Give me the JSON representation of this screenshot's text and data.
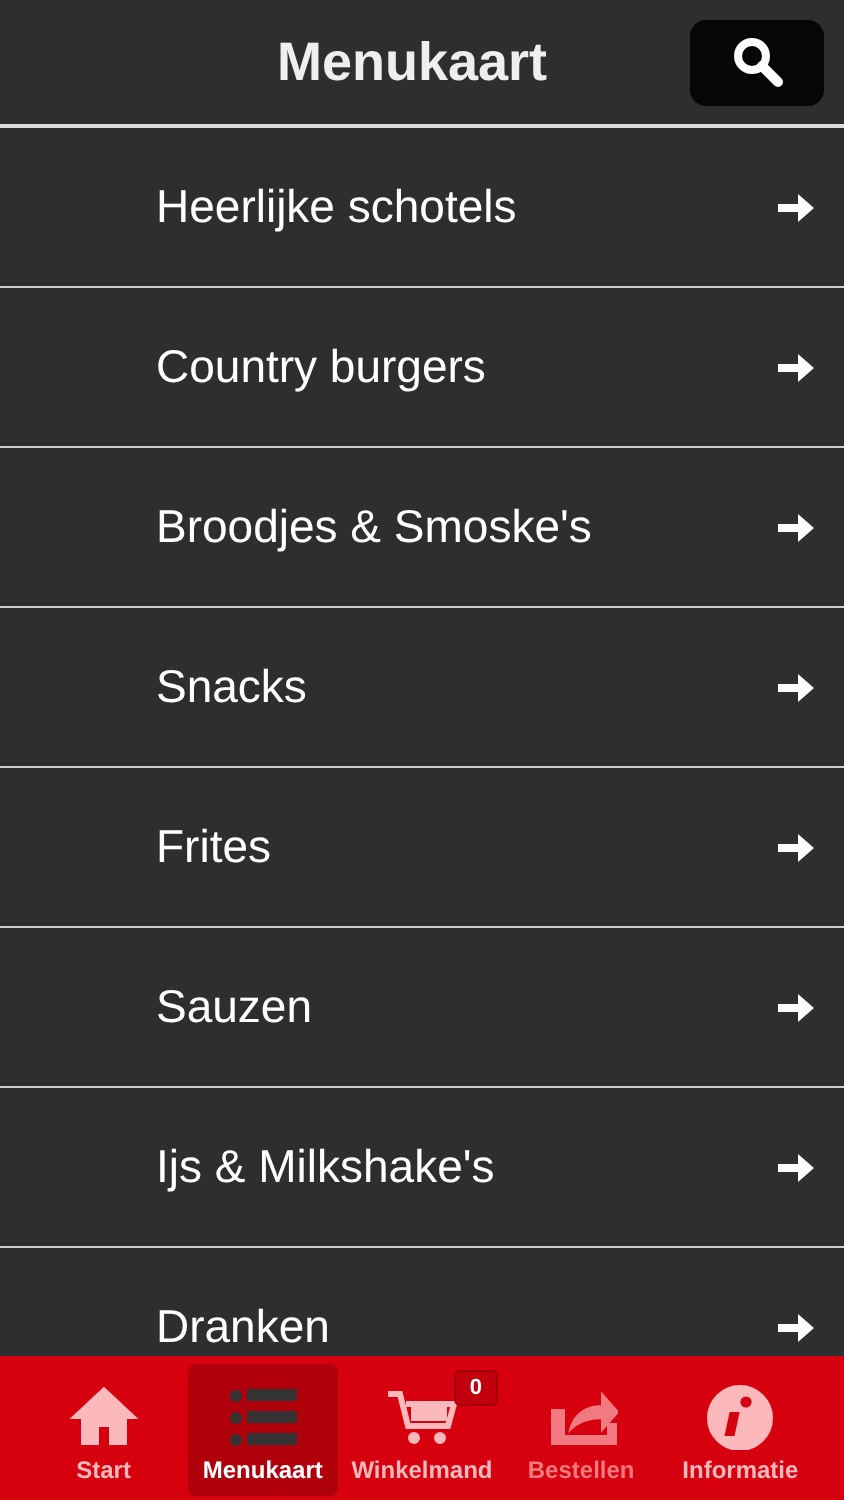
{
  "header": {
    "title": "Menukaart"
  },
  "categories": [
    {
      "label": "Heerlijke schotels"
    },
    {
      "label": "Country burgers"
    },
    {
      "label": "Broodjes & Smoske's"
    },
    {
      "label": "Snacks"
    },
    {
      "label": "Frites"
    },
    {
      "label": "Sauzen"
    },
    {
      "label": "Ijs & Milkshake's"
    },
    {
      "label": "Dranken"
    }
  ],
  "tab_bar": [
    {
      "label": "Start",
      "kind": "home",
      "selected": false,
      "disabled": false
    },
    {
      "label": "Menukaart",
      "kind": "list",
      "selected": true,
      "disabled": false
    },
    {
      "label": "Winkelmand",
      "kind": "cart",
      "selected": false,
      "disabled": false,
      "badge": "0"
    },
    {
      "label": "Bestellen",
      "kind": "share",
      "selected": false,
      "disabled": true
    },
    {
      "label": "Informatie",
      "kind": "info",
      "selected": false,
      "disabled": false
    }
  ]
}
